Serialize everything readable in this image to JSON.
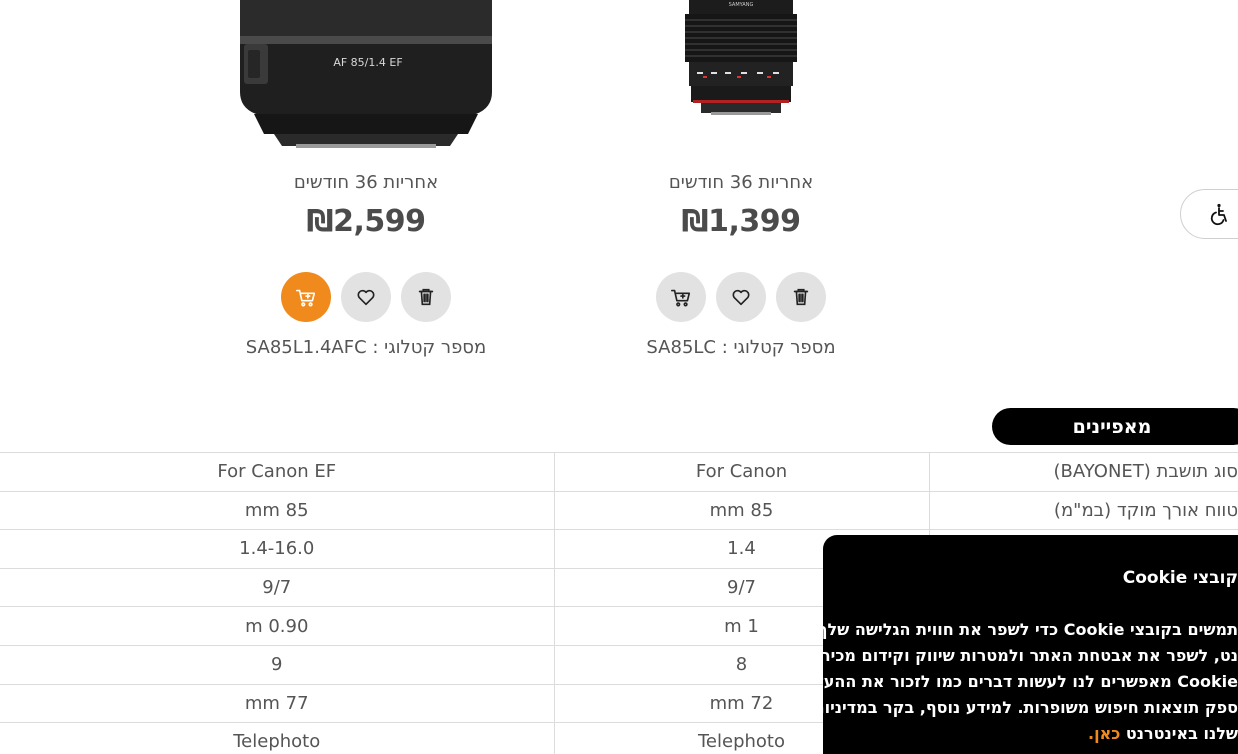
{
  "products": [
    {
      "lens_text": "AF 85/1.4 EF",
      "warranty": "אחריות 36 חודשים",
      "price": "₪2,599",
      "catalog": "מספר קטלוגי : SA85L1.4AFC",
      "cart_active": true
    },
    {
      "lens_text": "SAMYANG",
      "warranty": "אחריות 36 חודשים",
      "price": "₪1,399",
      "catalog": "מספר קטלוגי : SA85LC",
      "cart_active": false
    }
  ],
  "icons": {
    "cart": "add-to-cart-icon",
    "wishlist": "heart-icon",
    "remove": "trash-icon",
    "accessibility": "wheelchair-icon"
  },
  "colors": {
    "accent": "#f08a1c",
    "button_bg": "#e2e2e2",
    "pill_bg": "#000000"
  },
  "features_tab": "מאפיינים",
  "spec_rows": [
    {
      "label": "סוג תושבת (BAYONET)",
      "col_a": "For Canon",
      "col_b": "For Canon EF"
    },
    {
      "label": "טווח אורך מוקד (במ\"מ)",
      "col_a": "mm 85",
      "col_b": "mm 85"
    },
    {
      "label": "",
      "col_a": "1.4",
      "col_b": "1.4-16.0"
    },
    {
      "label": "",
      "col_a": "9/7",
      "col_b": "9/7"
    },
    {
      "label": "",
      "col_a": "m 1",
      "col_b": "m 0.90"
    },
    {
      "label": "",
      "col_a": "8",
      "col_b": "9"
    },
    {
      "label": "",
      "col_a": "mm 72",
      "col_b": "mm 77"
    },
    {
      "label": "",
      "col_a": "Telephoto",
      "col_b": "Telephoto"
    }
  ],
  "cookie": {
    "title": "קובצי Cookie",
    "lines": [
      "תמשים בקובצי Cookie כדי לשפר את חווית הגלישה שלך",
      "נט, לשפר את אבטחת האתר ולמטרות שיווק וקידום מכירות.",
      "Cookie מאפשרים לנו לעשות דברים כמו לזכור את ההעדפות",
      "ספק תוצאות חיפוש משופרות. למידע נוסף, בקר במדיניות",
      "שלנו באינטרנט"
    ],
    "link": "כאן."
  }
}
